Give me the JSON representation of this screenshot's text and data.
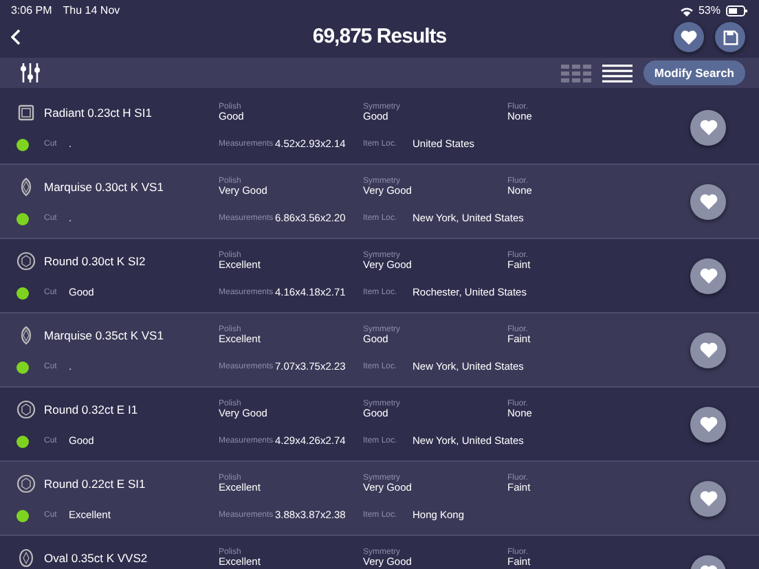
{
  "status_bar": {
    "time": "3:06 PM",
    "date": "Thu 14 Nov",
    "battery": "53%"
  },
  "header": {
    "title": "69,875 Results"
  },
  "toolbar": {
    "view_options": [
      {
        "kind": "grid",
        "selected": false
      },
      {
        "kind": "list",
        "selected": true
      }
    ],
    "button": "Modify Search"
  },
  "results": [
    {
      "kind": "radiant",
      "title": "Radiant 0.23ct H SI1",
      "color": "#7ed321",
      "cut_label": "Cut",
      "cut": ".",
      "polish_label": "Polish",
      "polish": "Good",
      "symmetry_label": "Symmetry",
      "symmetry": "Good",
      "fluor_label": "Fluor.",
      "fluor": "None",
      "measurements_label": "Measurements",
      "measurements": "4.52x2.93x2.14",
      "location_label": "Item Loc.",
      "location": "United States"
    },
    {
      "kind": "marquise",
      "title": "Marquise 0.30ct K VS1",
      "color": "#7ed321",
      "cut_label": "Cut",
      "cut": ".",
      "polish_label": "Polish",
      "polish": "Very Good",
      "symmetry_label": "Symmetry",
      "symmetry": "Very Good",
      "fluor_label": "Fluor.",
      "fluor": "None",
      "measurements_label": "Measurements",
      "measurements": "6.86x3.56x2.20",
      "location_label": "Item Loc.",
      "location": "New York, United States"
    },
    {
      "kind": "round",
      "title": "Round 0.30ct K SI2",
      "color": "#7ed321",
      "cut_label": "Cut",
      "cut": "Good",
      "polish_label": "Polish",
      "polish": "Excellent",
      "symmetry_label": "Symmetry",
      "symmetry": "Very Good",
      "fluor_label": "Fluor.",
      "fluor": "Faint",
      "measurements_label": "Measurements",
      "measurements": "4.16x4.18x2.71",
      "location_label": "Item Loc.",
      "location": "Rochester, United States"
    },
    {
      "kind": "marquise",
      "title": "Marquise 0.35ct K VS1",
      "color": "#7ed321",
      "cut_label": "Cut",
      "cut": ".",
      "polish_label": "Polish",
      "polish": "Excellent",
      "symmetry_label": "Symmetry",
      "symmetry": "Good",
      "fluor_label": "Fluor.",
      "fluor": "Faint",
      "measurements_label": "Measurements",
      "measurements": "7.07x3.75x2.23",
      "location_label": "Item Loc.",
      "location": "New York, United States"
    },
    {
      "kind": "round",
      "title": "Round 0.32ct E I1",
      "color": "#7ed321",
      "cut_label": "Cut",
      "cut": "Good",
      "polish_label": "Polish",
      "polish": "Very Good",
      "symmetry_label": "Symmetry",
      "symmetry": "Good",
      "fluor_label": "Fluor.",
      "fluor": "None",
      "measurements_label": "Measurements",
      "measurements": "4.29x4.26x2.74",
      "location_label": "Item Loc.",
      "location": "New York, United States"
    },
    {
      "kind": "round",
      "title": "Round 0.22ct E SI1",
      "color": "#7ed321",
      "cut_label": "Cut",
      "cut": "Excellent",
      "polish_label": "Polish",
      "polish": "Excellent",
      "symmetry_label": "Symmetry",
      "symmetry": "Very Good",
      "fluor_label": "Fluor.",
      "fluor": "Faint",
      "measurements_label": "Measurements",
      "measurements": "3.88x3.87x2.38",
      "location_label": "Item Loc.",
      "location": "Hong Kong"
    },
    {
      "kind": "oval",
      "title": "Oval 0.35ct K VVS2",
      "polish_label": "Polish",
      "polish": "Excellent",
      "symmetry_label": "Symmetry",
      "symmetry": "Very Good",
      "fluor_label": "Fluor.",
      "fluor": "Faint"
    }
  ]
}
